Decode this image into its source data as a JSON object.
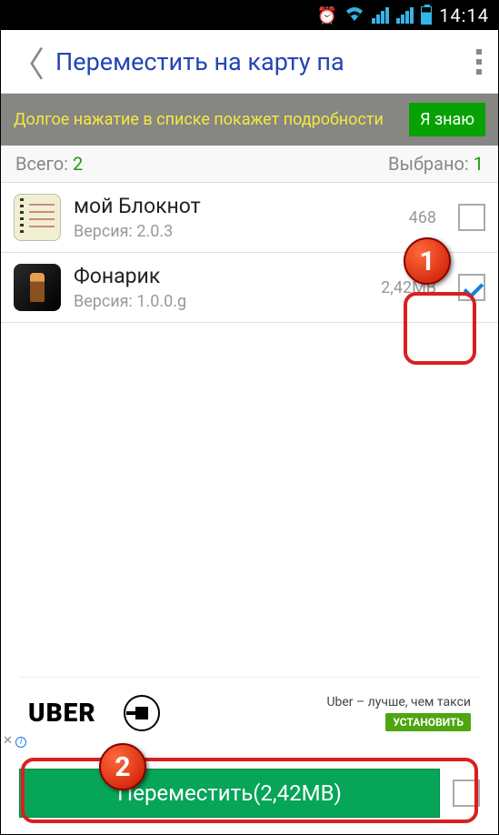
{
  "status": {
    "time": "14:14"
  },
  "header": {
    "title": "Переместить на карту па",
    "back": "〈"
  },
  "tip": {
    "text": "Долгое нажатие в списке покажет подробности",
    "button": "Я знаю"
  },
  "counts": {
    "total_label": "Всего:",
    "total_value": "2",
    "selected_label": "Выбрано:",
    "selected_value": "1"
  },
  "apps": [
    {
      "name": "мой Блокнот",
      "version_label": "Версия: 2.0.3",
      "size": "468",
      "checked": false
    },
    {
      "name": "Фонарик",
      "version_label": "Версия: 1.0.0.g",
      "size": "2,42MB",
      "checked": true
    }
  ],
  "ad": {
    "brand": "UBER",
    "headline": "Uber – лучше, чем такси",
    "install": "УСТАНОВИТЬ",
    "marker": "✕"
  },
  "footer": {
    "move": "Переместить(2,42MB)"
  },
  "callouts": {
    "b1": "1",
    "b2": "2"
  }
}
